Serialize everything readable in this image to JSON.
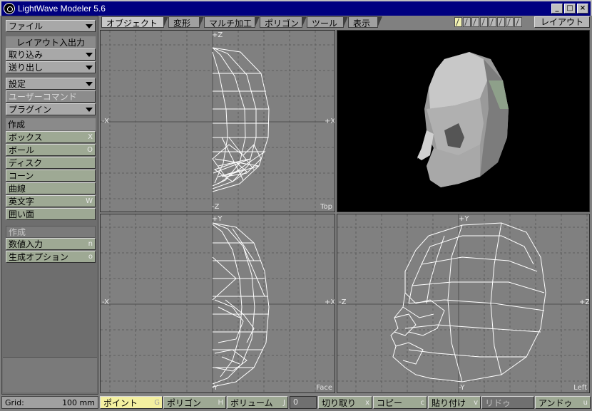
{
  "window": {
    "title": "LightWave Modeler 5.6",
    "min": "_",
    "max": "□",
    "close": "×"
  },
  "left_panel": {
    "file": "ファイル",
    "layout_io_header": "レイアウト入出力",
    "import": "取り込み",
    "export": "送り出し",
    "settings": "設定",
    "user_commands": "ユーザーコマンド",
    "plugins": "プラグイン",
    "create_header": "作成",
    "create_items": [
      {
        "label": "ボックス",
        "key": "X"
      },
      {
        "label": "ボール",
        "key": "O"
      },
      {
        "label": "ディスク",
        "key": ""
      },
      {
        "label": "コーン",
        "key": ""
      },
      {
        "label": "曲線",
        "key": ""
      },
      {
        "label": "英文字",
        "key": "W"
      },
      {
        "label": "囲い面",
        "key": ""
      }
    ],
    "create_header2": "作成",
    "numeric": {
      "label": "数値入力",
      "key": "n"
    },
    "gen_options": {
      "label": "生成オプション",
      "key": "o"
    }
  },
  "tabs": [
    "オブジェクト",
    "変形",
    "マルチ加工",
    "ポリゴン",
    "ツール",
    "表示"
  ],
  "active_tab": "オブジェクト",
  "layout_button": "レイアウト",
  "layers": {
    "count": 10,
    "active": 1
  },
  "viewports": {
    "top": {
      "name": "Top",
      "up": "+Z",
      "down": "-Z",
      "left": "-X",
      "right": "+X"
    },
    "face": {
      "name": "Face",
      "up": "+Y",
      "down": "-Y",
      "left": "-X",
      "right": "+X"
    },
    "left": {
      "name": "Left",
      "up": "+Y",
      "down": "-Y",
      "left": "-Z",
      "right": "+Z"
    }
  },
  "bottom": {
    "grid_label": "Grid:",
    "grid_value": "100 mm",
    "modes": [
      {
        "label": "ポイント",
        "key": "G"
      },
      {
        "label": "ポリゴン",
        "key": "H"
      },
      {
        "label": "ボリューム",
        "key": "J"
      }
    ],
    "selected_count": "0",
    "actions": [
      {
        "label": "切り取り",
        "key": "x"
      },
      {
        "label": "コピー",
        "key": "c"
      },
      {
        "label": "貼り付け",
        "key": "v"
      },
      {
        "label": "リドゥ",
        "key": ""
      },
      {
        "label": "アンドゥ",
        "key": "u"
      }
    ]
  },
  "colors": {
    "title_bg": "#000080",
    "panel_btn": "#9ea994",
    "point_mode": "#f4f0a0",
    "wire": "#ffffff"
  }
}
